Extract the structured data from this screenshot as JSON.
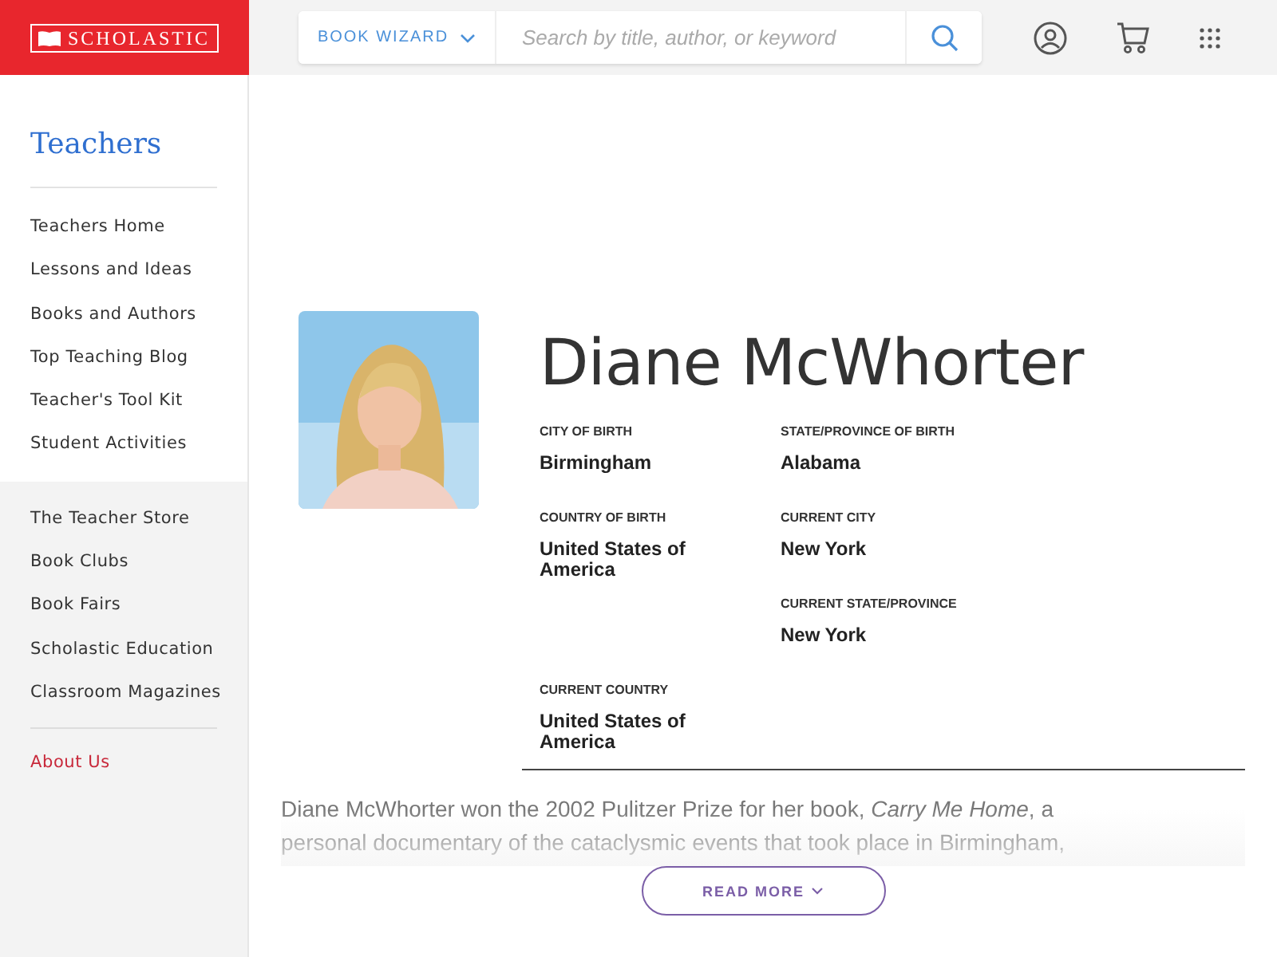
{
  "header": {
    "logo": "SCHOLASTIC",
    "wizard": "BOOK WIZARD",
    "search": {
      "placeholder": "Search by title, author, or keyword"
    }
  },
  "sidebar": {
    "title": "Teachers",
    "groups": [
      {
        "items": [
          {
            "label": "Teachers Home"
          },
          {
            "label": "Lessons and Ideas"
          },
          {
            "label": "Books and Authors"
          },
          {
            "label": "Top Teaching Blog"
          },
          {
            "label": "Teacher's Tool Kit"
          },
          {
            "label": "Student Activities"
          }
        ]
      },
      {
        "items": [
          {
            "label": "The Teacher Store"
          },
          {
            "label": "Book Clubs"
          },
          {
            "label": "Book Fairs"
          },
          {
            "label": "Scholastic Education"
          },
          {
            "label": "Classroom Magazines"
          }
        ]
      },
      {
        "items": [
          {
            "label": "About Us",
            "kind": "highlight"
          }
        ]
      }
    ]
  },
  "author": {
    "name": "Diane McWhorter",
    "facts": [
      {
        "label": "CITY OF BIRTH",
        "value": "Birmingham"
      },
      {
        "label": "STATE/PROVINCE OF BIRTH",
        "value": "Alabama"
      },
      {
        "label": "COUNTRY OF BIRTH",
        "value": "United States of America"
      },
      {
        "label": "CURRENT CITY",
        "value": "New York"
      },
      {
        "label": "CURRENT STATE/PROVINCE",
        "value": "New York"
      },
      {
        "label": "CURRENT COUNTRY",
        "value": "United States of America"
      }
    ],
    "bio": "Diane McWhorter won the 2002 Pulitzer Prize for her book, *Carry Me Home*, a personal documentary of the cataclysmic events that took place in Birmingham,",
    "read_more": "READ MORE"
  }
}
